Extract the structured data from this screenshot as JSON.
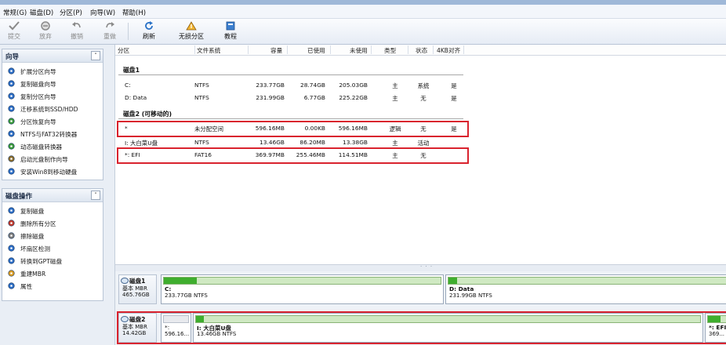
{
  "menu": [
    "常规(G)",
    "磁盘(D)",
    "分区(P)",
    "向导(W)",
    "帮助(H)"
  ],
  "toolbar": {
    "commit": "提交",
    "discard": "放弃",
    "undo": "撤销",
    "redo": "重做",
    "refresh": "刷新",
    "lossless": "无损分区",
    "tutorial": "教程"
  },
  "wizard_panel": {
    "title": "向导",
    "items": [
      "扩展分区向导",
      "复制磁盘向导",
      "复制分区向导",
      "迁移系统到SSD/HDD",
      "分区恢复向导",
      "NTFS与FAT32转换器",
      "动态磁盘转换器",
      "启动光盘制作向导",
      "安装Win8到移动硬盘"
    ]
  },
  "disk_ops_panel": {
    "title": "磁盘操作",
    "items": [
      "复制磁盘",
      "删除所有分区",
      "擦除磁盘",
      "坏扇区检测",
      "转换到GPT磁盘",
      "重建MBR",
      "属性"
    ]
  },
  "table": {
    "headers": [
      "分区",
      "文件系统",
      "容量",
      "已使用",
      "未使用",
      "类型",
      "状态",
      "4KB对齐"
    ],
    "disk1": {
      "title": "磁盘1",
      "rows": [
        [
          "C:",
          "NTFS",
          "233.77GB",
          "28.74GB",
          "205.03GB",
          "主",
          "系统",
          "是"
        ],
        [
          "D: Data",
          "NTFS",
          "231.99GB",
          "6.77GB",
          "225.22GB",
          "主",
          "无",
          "是"
        ]
      ]
    },
    "disk2": {
      "title": "磁盘2 (可移动的)",
      "rows": [
        [
          "*",
          "未分配空间",
          "596.16MB",
          "0.00KB",
          "596.16MB",
          "逻辑",
          "无",
          "是"
        ],
        [
          "I: 大白菜U盘",
          "NTFS",
          "13.46GB",
          "86.20MB",
          "13.38GB",
          "主",
          "活动",
          ""
        ],
        [
          "*: EFI",
          "FAT16",
          "369.97MB",
          "255.46MB",
          "114.51MB",
          "主",
          "无",
          ""
        ]
      ]
    }
  },
  "diskmap": {
    "disk1": {
      "name": "磁盘1",
      "type": "基本 MBR",
      "size": "465.76GB",
      "partitions": [
        {
          "name": "C:",
          "info": "233.77GB NTFS",
          "used_fraction": 0.12
        },
        {
          "name": "D: Data",
          "info": "231.99GB NTFS",
          "used_fraction": 0.03
        }
      ]
    },
    "disk2": {
      "name": "磁盘2",
      "type": "基本 MBR",
      "size": "14.42GB",
      "partitions": [
        {
          "name": "*:",
          "info": "596.16...",
          "used_fraction": 0
        },
        {
          "name": "I: 大白菜U盘",
          "info": "13.46GB NTFS",
          "used_fraction": 0.01
        },
        {
          "name": "*: EFI",
          "info": "369...",
          "used_fraction": 0.69
        }
      ]
    }
  },
  "colors": {
    "highlight": "#d9232e",
    "used": "#3fae2e",
    "free": "#cfe9c2"
  }
}
